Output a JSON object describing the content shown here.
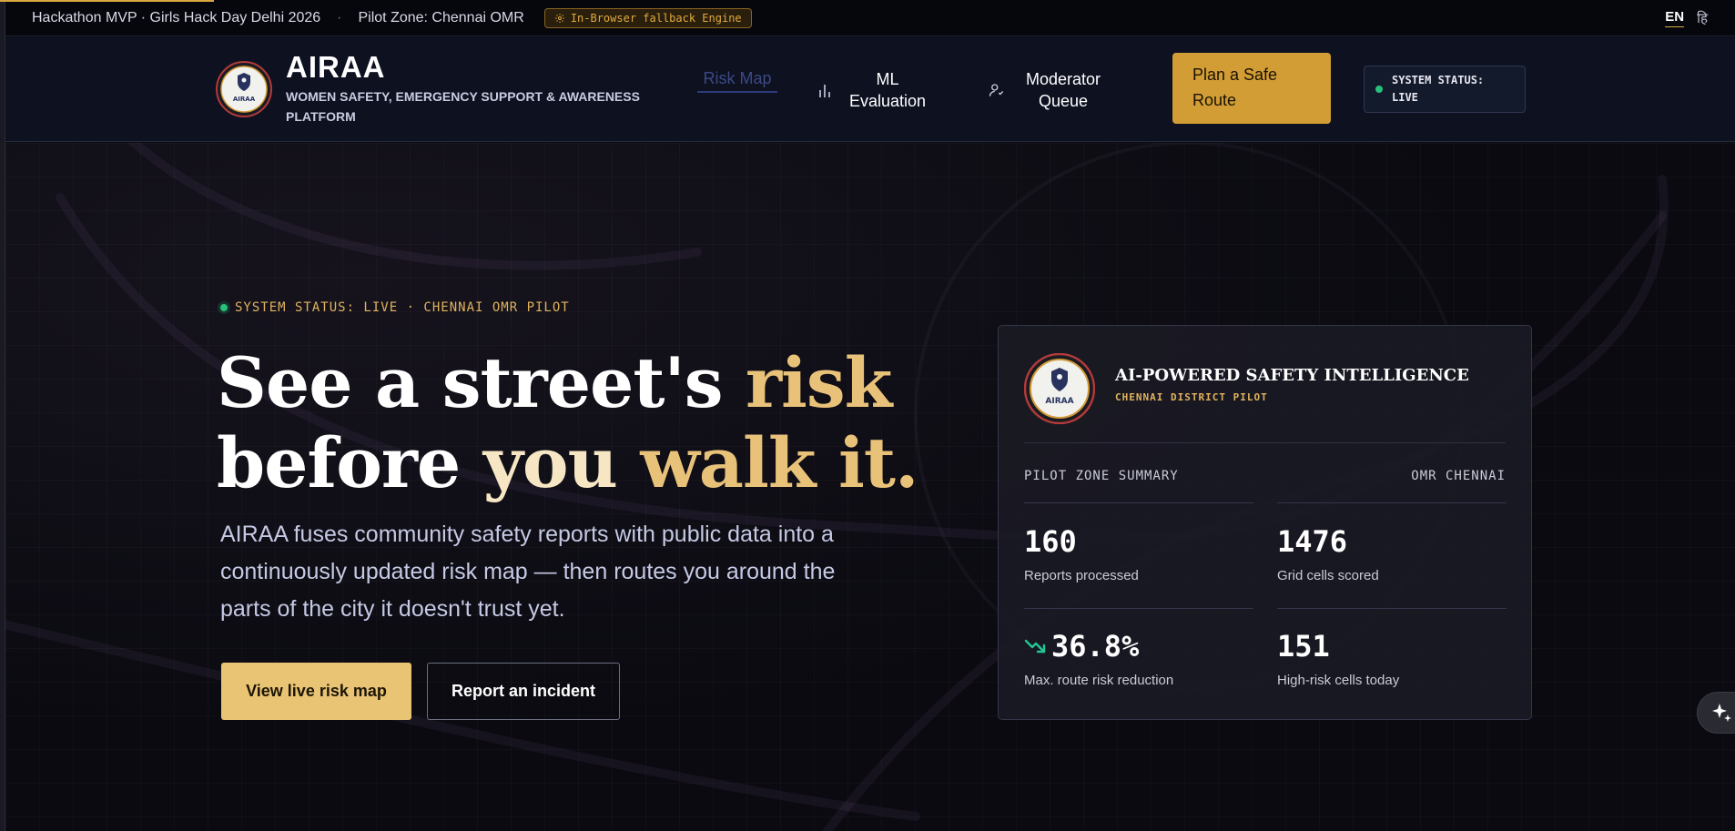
{
  "topbar": {
    "event": "Hackathon MVP · Girls Hack Day Delhi 2026",
    "separator": "·",
    "pilot_zone": "Pilot Zone: Chennai OMR",
    "fallback_badge": "In-Browser fallback Engine",
    "lang_en": "EN",
    "lang_hi": "हि"
  },
  "header": {
    "brand": "AIRAA",
    "tagline": "WOMEN SAFETY, EMERGENCY SUPPORT & AWARENESS PLATFORM",
    "logo_text": "AIRAA",
    "nav": {
      "risk_map": "Risk Map",
      "ml_evaluation": "ML Evaluation",
      "moderator_queue": "Moderator Queue"
    },
    "plan_button": "Plan a Safe Route",
    "status": "SYSTEM STATUS: LIVE"
  },
  "hero": {
    "live_label": "SYSTEM STATUS: LIVE · CHENNAI OMR PILOT",
    "headline": {
      "part1": "See a street's ",
      "part2": "risk",
      "part3": "before ",
      "part4": "you ",
      "part5": "walk it."
    },
    "lede": "AIRAA fuses community safety reports with public data into a continuously updated risk map — then routes you around the parts of the city it doesn't trust yet.",
    "primary_button": "View live risk map",
    "secondary_button": "Report an incident"
  },
  "card": {
    "title": "AI-POWERED SAFETY INTELLIGENCE",
    "subtitle": "CHENNAI DISTRICT PILOT",
    "summary_label": "PILOT ZONE SUMMARY",
    "summary_value": "OMR CHENNAI",
    "stats": [
      {
        "value": "160",
        "label": "Reports processed"
      },
      {
        "value": "1476",
        "label": "Grid cells scored"
      },
      {
        "value": "36.8%",
        "label": "Max. route risk reduction"
      },
      {
        "value": "151",
        "label": "High-risk cells today"
      }
    ]
  },
  "colors": {
    "accent_gold": "#d29d34",
    "live_green": "#27c07a",
    "trend_green": "#22c793"
  },
  "icons": {
    "fallback": "gear-icon",
    "ml": "bar-chart-icon",
    "moderator": "user-check-icon",
    "trend": "trending-down-icon",
    "fab": "sparkle-icon"
  }
}
